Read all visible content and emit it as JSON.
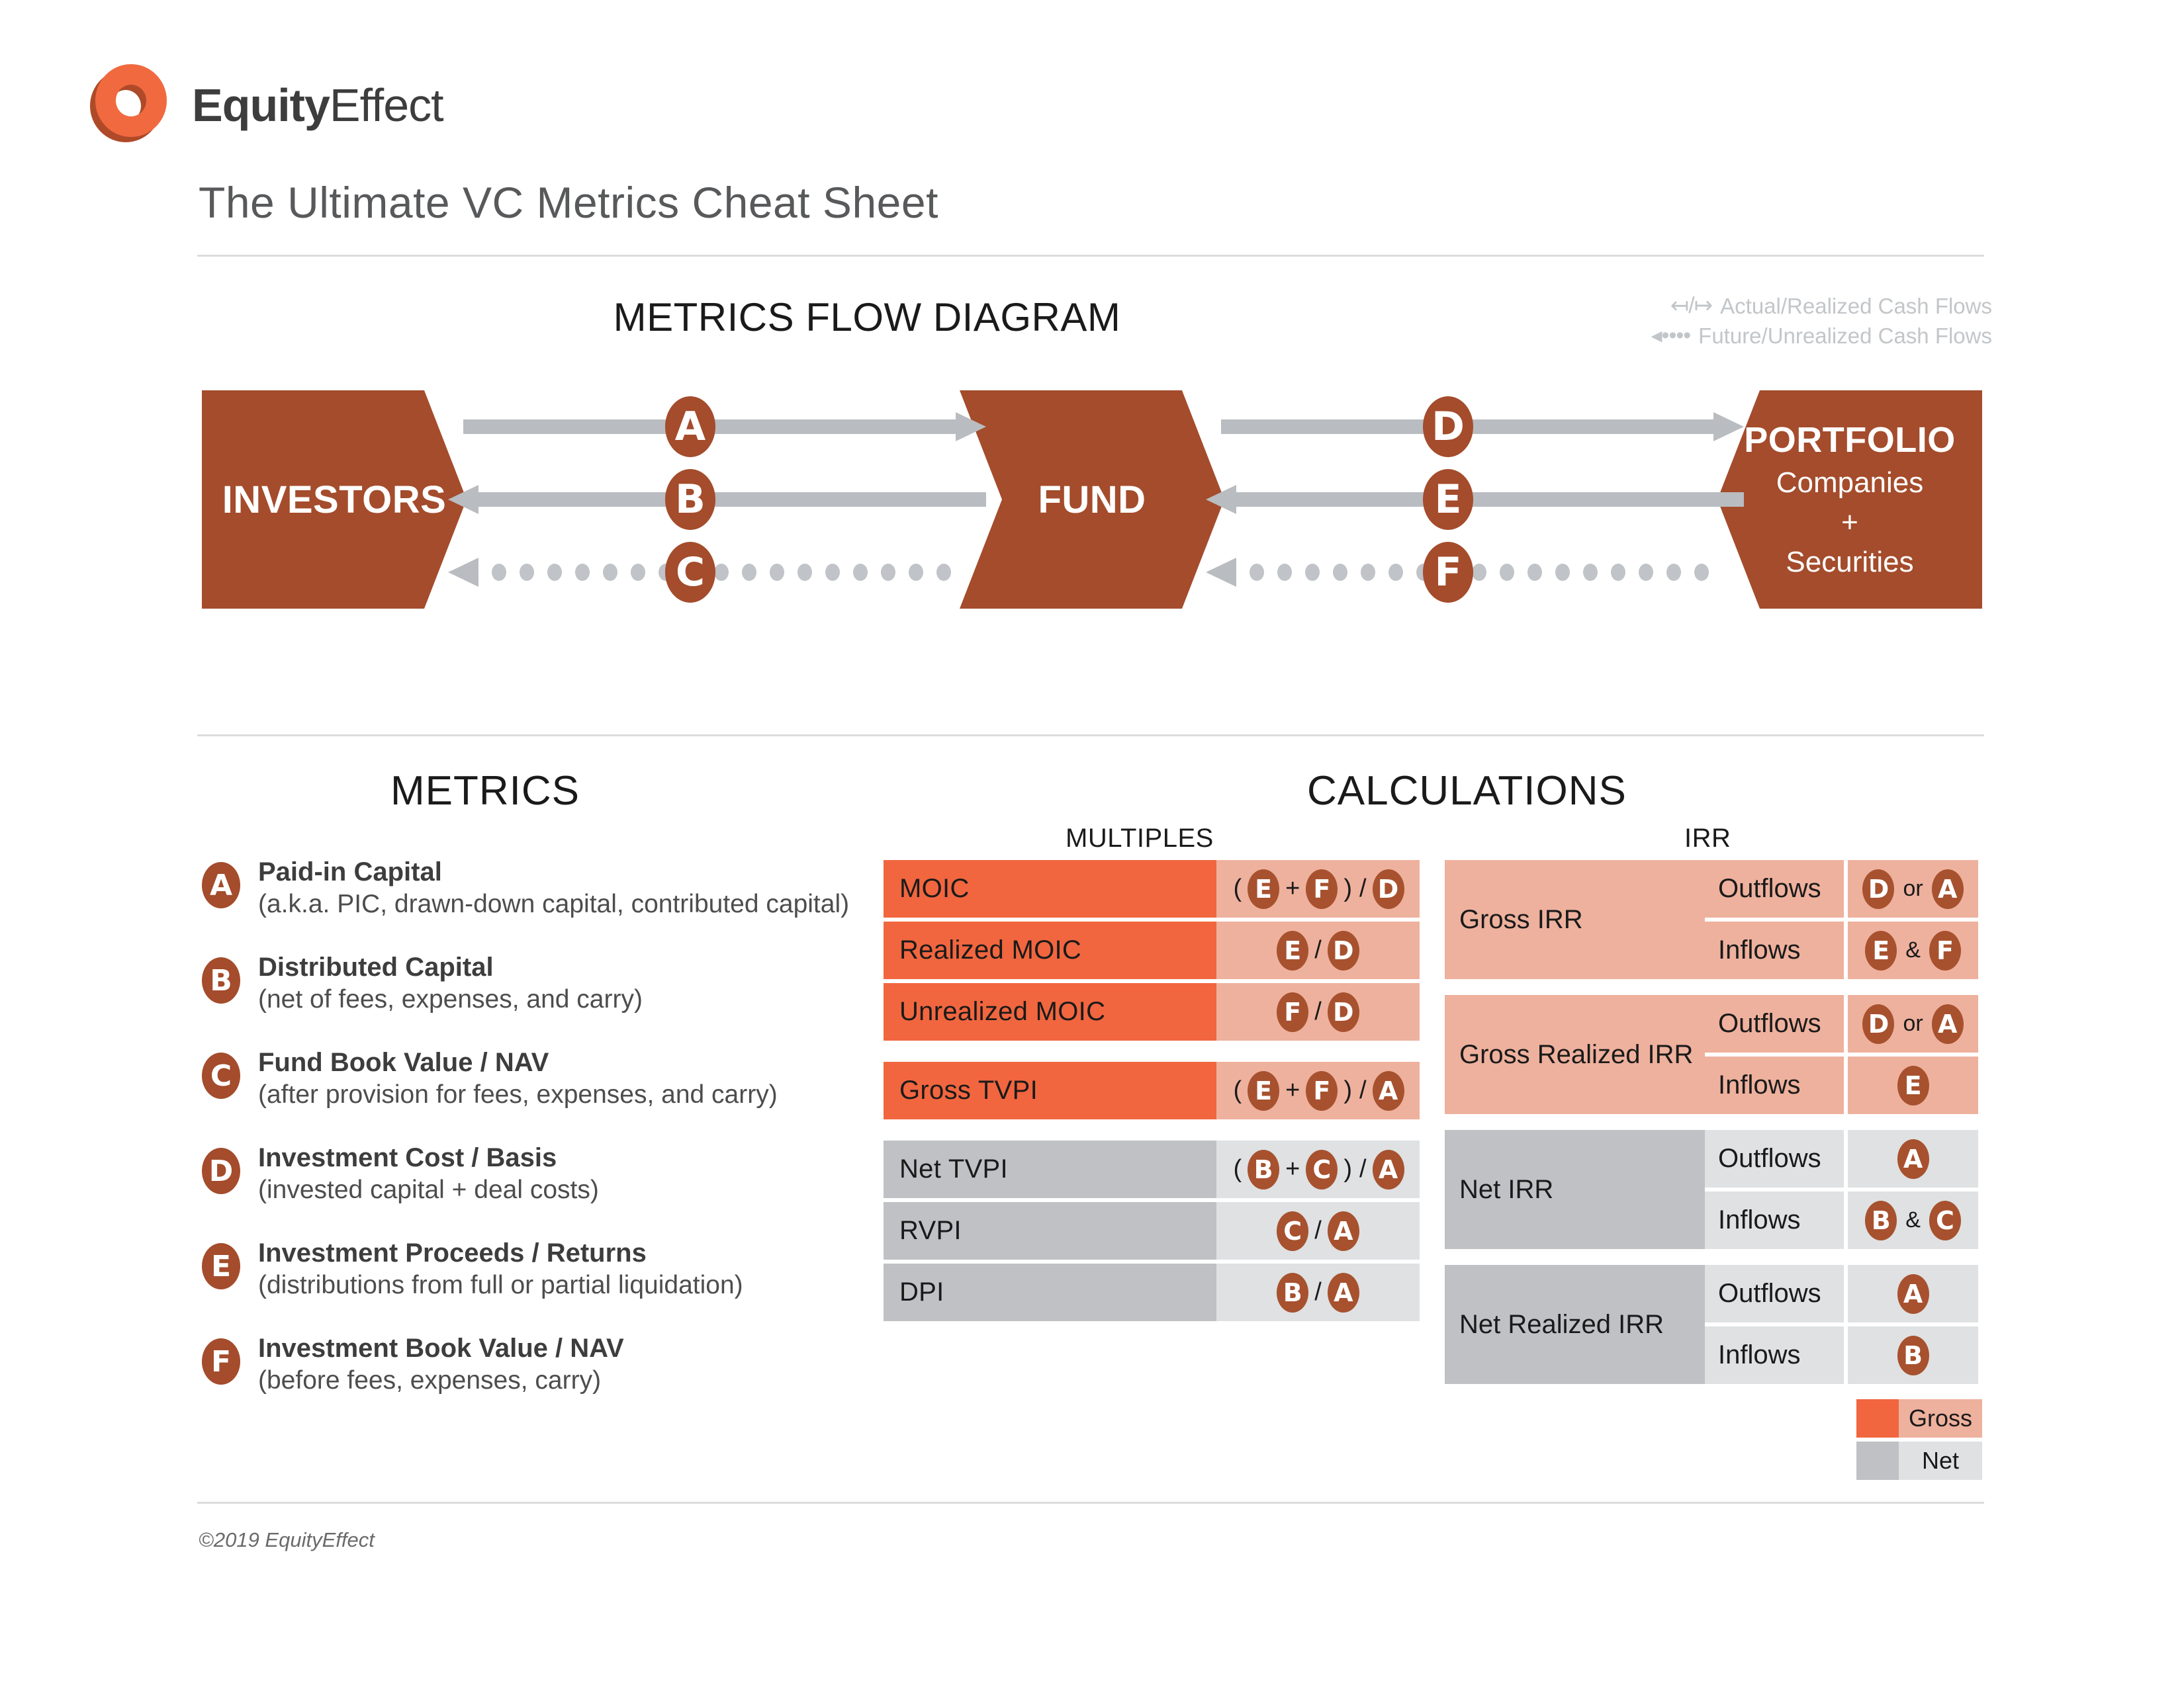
{
  "brand": {
    "name_bold": "Equity",
    "name_light": "Effect",
    "red": "#A44C2C",
    "orange": "#F1663F",
    "orange_light": "#EEB19D",
    "gray": "#BFC1C4",
    "gray_light": "#DFE1E2"
  },
  "header": {
    "title": "The Ultimate VC Metrics Cheat Sheet"
  },
  "flow": {
    "title": "METRICS FLOW DIAGRAM",
    "legend": [
      {
        "glyph": "↤/↦",
        "label": "Actual/Realized Cash Flows"
      },
      {
        "glyph": "◂••••",
        "label": "Future/Unrealized Cash Flows"
      }
    ],
    "nodes": {
      "investors": {
        "title": "INVESTORS"
      },
      "fund": {
        "title": "FUND"
      },
      "portfolio": {
        "title": "PORTFOLIO",
        "line1": "Companies",
        "line2": "+",
        "line3": "Securities"
      }
    },
    "arrows": [
      {
        "id": "A",
        "direction": "right",
        "style": "solid",
        "from": "investors",
        "to": "fund"
      },
      {
        "id": "B",
        "direction": "left",
        "style": "solid",
        "from": "fund",
        "to": "investors"
      },
      {
        "id": "C",
        "direction": "left",
        "style": "dotted",
        "from": "fund",
        "to": "investors"
      },
      {
        "id": "D",
        "direction": "right",
        "style": "solid",
        "from": "fund",
        "to": "portfolio"
      },
      {
        "id": "E",
        "direction": "left",
        "style": "solid",
        "from": "portfolio",
        "to": "fund"
      },
      {
        "id": "F",
        "direction": "left",
        "style": "dotted",
        "from": "portfolio",
        "to": "fund"
      }
    ]
  },
  "sections": {
    "metrics_heading": "METRICS",
    "calculations_heading": "CALCULATIONS",
    "multiples_heading": "MULTIPLES",
    "irr_heading": "IRR"
  },
  "metrics": [
    {
      "id": "A",
      "name": "Paid-in Capital",
      "desc": "(a.k.a. PIC, drawn-down capital, contributed capital)"
    },
    {
      "id": "B",
      "name": "Distributed Capital",
      "desc": "(net of fees, expenses, and carry)"
    },
    {
      "id": "C",
      "name": "Fund Book Value / NAV",
      "desc": "(after provision for fees, expenses, and carry)"
    },
    {
      "id": "D",
      "name": "Investment Cost / Basis",
      "desc": "(invested capital + deal costs)"
    },
    {
      "id": "E",
      "name": "Investment Proceeds / Returns",
      "desc": "(distributions from full or partial liquidation)"
    },
    {
      "id": "F",
      "name": "Investment Book Value / NAV",
      "desc": "(before fees, expenses, carry)"
    }
  ],
  "multiples": {
    "gross": [
      {
        "label": "MOIC",
        "formula": [
          {
            "t": "op",
            "v": "("
          },
          {
            "t": "pill",
            "v": "E"
          },
          {
            "t": "op",
            "v": "+"
          },
          {
            "t": "pill",
            "v": "F"
          },
          {
            "t": "op",
            "v": ")"
          },
          {
            "t": "op",
            "v": "/"
          },
          {
            "t": "pill",
            "v": "D"
          }
        ]
      },
      {
        "label": "Realized MOIC",
        "formula": [
          {
            "t": "pill",
            "v": "E"
          },
          {
            "t": "op",
            "v": "/"
          },
          {
            "t": "pill",
            "v": "D"
          }
        ]
      },
      {
        "label": "Unrealized MOIC",
        "formula": [
          {
            "t": "pill",
            "v": "F"
          },
          {
            "t": "op",
            "v": "/"
          },
          {
            "t": "pill",
            "v": "D"
          }
        ]
      }
    ],
    "gross_extra": [
      {
        "label": "Gross TVPI",
        "formula": [
          {
            "t": "op",
            "v": "("
          },
          {
            "t": "pill",
            "v": "E"
          },
          {
            "t": "op",
            "v": "+"
          },
          {
            "t": "pill",
            "v": "F"
          },
          {
            "t": "op",
            "v": ")"
          },
          {
            "t": "op",
            "v": "/"
          },
          {
            "t": "pill",
            "v": "A"
          }
        ]
      }
    ],
    "net": [
      {
        "label": "Net TVPI",
        "formula": [
          {
            "t": "op",
            "v": "("
          },
          {
            "t": "pill",
            "v": "B"
          },
          {
            "t": "op",
            "v": "+"
          },
          {
            "t": "pill",
            "v": "C"
          },
          {
            "t": "op",
            "v": ")"
          },
          {
            "t": "op",
            "v": "/"
          },
          {
            "t": "pill",
            "v": "A"
          }
        ]
      },
      {
        "label": "RVPI",
        "formula": [
          {
            "t": "pill",
            "v": "C"
          },
          {
            "t": "op",
            "v": "/"
          },
          {
            "t": "pill",
            "v": "A"
          }
        ]
      },
      {
        "label": "DPI",
        "formula": [
          {
            "t": "pill",
            "v": "B"
          },
          {
            "t": "op",
            "v": "/"
          },
          {
            "t": "pill",
            "v": "A"
          }
        ]
      }
    ]
  },
  "irr": {
    "outflows_label": "Outflows",
    "inflows_label": "Inflows",
    "blocks": [
      {
        "name": "Gross IRR",
        "kind": "gross",
        "outflows": [
          {
            "t": "pill",
            "v": "D"
          },
          {
            "t": "word",
            "v": "or"
          },
          {
            "t": "pill",
            "v": "A"
          }
        ],
        "inflows": [
          {
            "t": "pill",
            "v": "E"
          },
          {
            "t": "word",
            "v": "&"
          },
          {
            "t": "pill",
            "v": "F"
          }
        ]
      },
      {
        "name": "Gross Realized IRR",
        "kind": "gross",
        "outflows": [
          {
            "t": "pill",
            "v": "D"
          },
          {
            "t": "word",
            "v": "or"
          },
          {
            "t": "pill",
            "v": "A"
          }
        ],
        "inflows": [
          {
            "t": "pill",
            "v": "E"
          }
        ]
      },
      {
        "name": "Net IRR",
        "kind": "net",
        "outflows": [
          {
            "t": "pill",
            "v": "A"
          }
        ],
        "inflows": [
          {
            "t": "pill",
            "v": "B"
          },
          {
            "t": "word",
            "v": "&"
          },
          {
            "t": "pill",
            "v": "C"
          }
        ]
      },
      {
        "name": "Net Realized IRR",
        "kind": "net",
        "outflows": [
          {
            "t": "pill",
            "v": "A"
          }
        ],
        "inflows": [
          {
            "t": "pill",
            "v": "B"
          }
        ]
      }
    ]
  },
  "key": [
    {
      "label": "Gross",
      "class": "k-gross"
    },
    {
      "label": "Net",
      "class": "k-net"
    }
  ],
  "footer": {
    "copyright": "©2019 EquityEffect"
  }
}
